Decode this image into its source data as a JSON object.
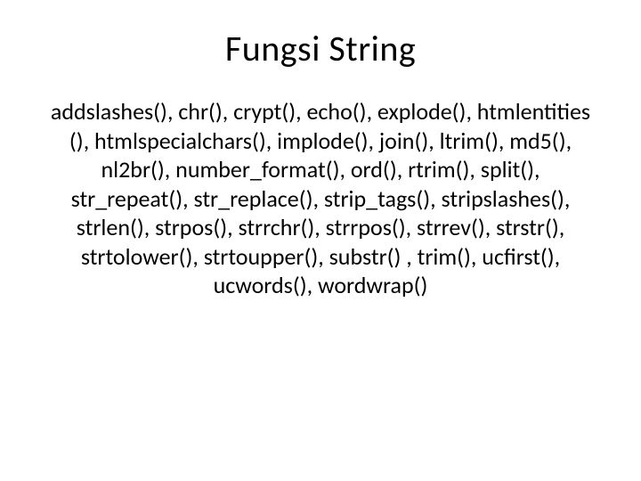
{
  "slide": {
    "title": "Fungsi String",
    "body": "addslashes(), chr(), crypt(), echo(), explode(), htmlentities (), htmlspecialchars(), implode(), join(), ltrim(), md5(), nl2br(), number_format(), ord(), rtrim(), split(), str_repeat(), str_replace(), strip_tags(), stripslashes(), strlen(), strpos(), strrchr(), strrpos(), strrev(), strstr(), strtolower(), strtoupper(), substr() , trim(), ucfirst(), ucwords(), wordwrap()"
  }
}
